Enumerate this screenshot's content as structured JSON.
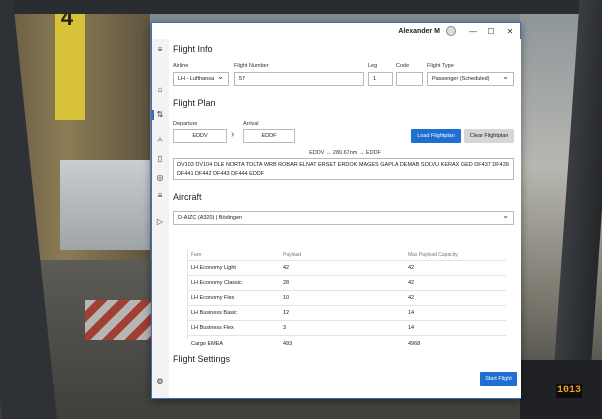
{
  "background": {
    "door_number": "4",
    "cockpit_display": "1013"
  },
  "window": {
    "user_name": "Alexander M",
    "controls": {
      "minimize": "—",
      "maximize": "☐",
      "close": "✕"
    }
  },
  "nav": {
    "icons": [
      "menu-icon",
      "home-icon",
      "flight-icon",
      "route-icon",
      "checklist-icon",
      "cargo-icon",
      "globe-icon",
      "list-icon",
      "play-icon",
      "settings-icon"
    ]
  },
  "flight_info": {
    "title": "Flight Info",
    "airline_label": "Airline",
    "airline_value": "LH - Lufthansa",
    "flight_number_label": "Flight Number",
    "flight_number_value": "57",
    "leg_label": "Leg",
    "leg_value": "1",
    "code_label": "Code",
    "code_value": "",
    "flight_type_label": "Flight Type",
    "flight_type_value": "Passenger (Scheduled)"
  },
  "flight_plan": {
    "title": "Flight Plan",
    "departure_label": "Departure",
    "departure_value": "EDDV",
    "arrival_label": "Arrival",
    "arrival_value": "EDDF",
    "load_button": "Load Flightplan",
    "clear_button": "Clear Flightplan",
    "summary": "EDDV → 280.67nm → EDDF",
    "route": "DV103 DV104 DLE NORTA TOLTA WRB ROBAR ELNAT ERSET ERDOK MAGES GAPLA DEMAB SOLVU KERAX GED DF437 DF439 DF441 DF442 DF443 DF444 EDDF"
  },
  "aircraft": {
    "title": "Aircraft",
    "selected": "D-AIZC (A320) | Bödingen",
    "columns": [
      "Fare",
      "Payload",
      "Max Payload Capacity"
    ],
    "rows": [
      [
        "LH Economy Light",
        "42",
        "42"
      ],
      [
        "LH Economy Classic",
        "28",
        "42"
      ],
      [
        "LH Economy Flex",
        "10",
        "42"
      ],
      [
        "LH Business Basic",
        "12",
        "14"
      ],
      [
        "LH Business Flex",
        "3",
        "14"
      ],
      [
        "Cargo EMEA",
        "493",
        "4968"
      ]
    ]
  },
  "flight_settings": {
    "title": "Flight Settings"
  },
  "start_button": "Start Flight"
}
